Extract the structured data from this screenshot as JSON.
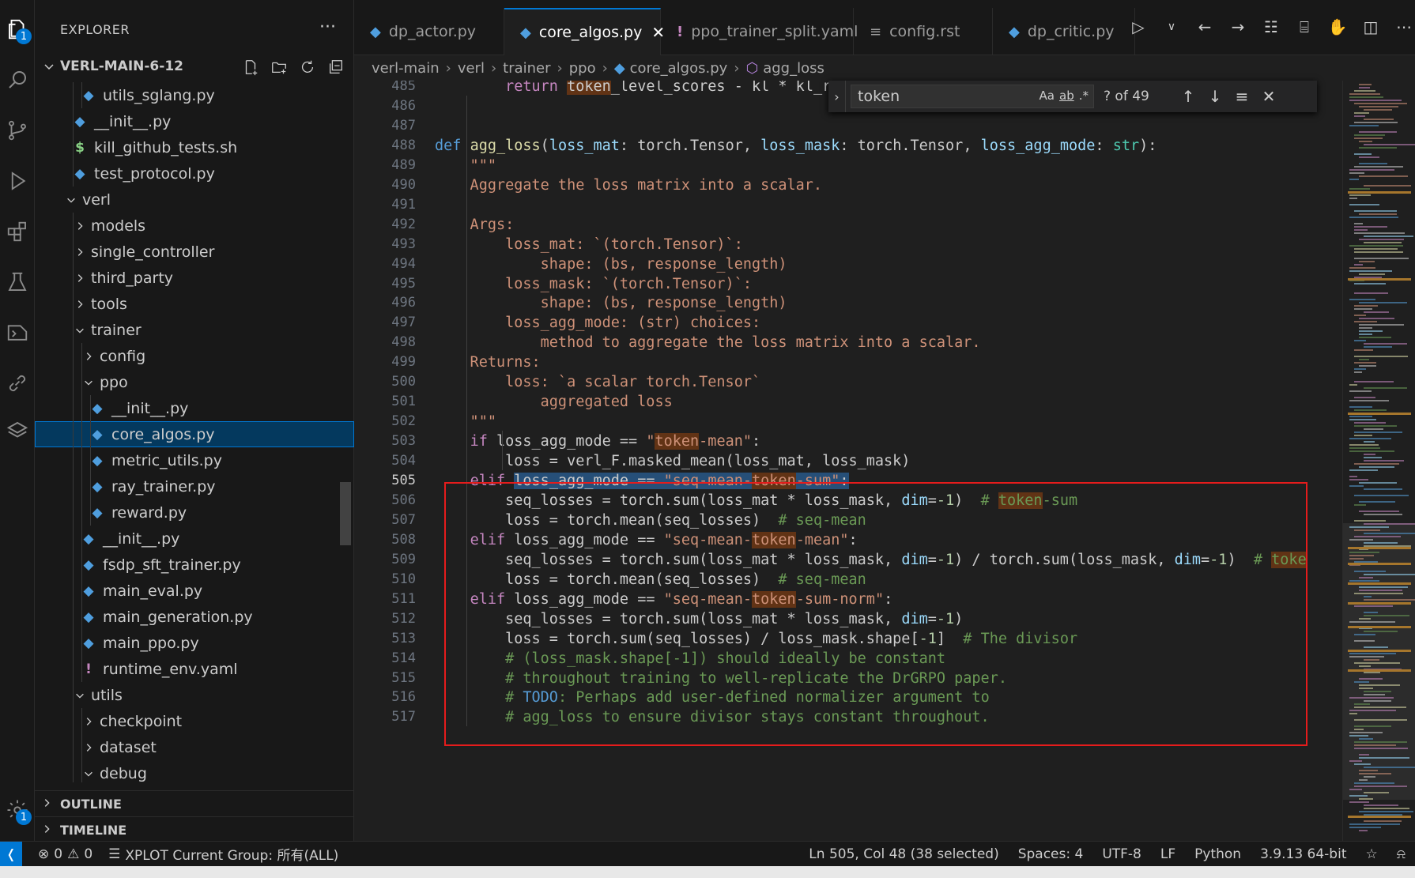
{
  "explorer": {
    "title": "EXPLORER",
    "more": "···",
    "root": "VERL-MAIN-6-12",
    "badge": "1",
    "tree": [
      {
        "label": "utils_sglang.py",
        "type": "py",
        "depth": 4
      },
      {
        "label": "__init__.py",
        "type": "py",
        "depth": 3
      },
      {
        "label": "kill_github_tests.sh",
        "type": "sh",
        "depth": 3
      },
      {
        "label": "test_protocol.py",
        "type": "py",
        "depth": 3
      },
      {
        "label": "verl",
        "type": "folder-open",
        "depth": 2
      },
      {
        "label": "models",
        "type": "folder",
        "depth": 3
      },
      {
        "label": "single_controller",
        "type": "folder",
        "depth": 3
      },
      {
        "label": "third_party",
        "type": "folder",
        "depth": 3
      },
      {
        "label": "tools",
        "type": "folder",
        "depth": 3
      },
      {
        "label": "trainer",
        "type": "folder-open",
        "depth": 3
      },
      {
        "label": "config",
        "type": "folder",
        "depth": 4
      },
      {
        "label": "ppo",
        "type": "folder-open",
        "depth": 4
      },
      {
        "label": "__init__.py",
        "type": "py",
        "depth": 5
      },
      {
        "label": "core_algos.py",
        "type": "py",
        "depth": 5,
        "selected": true
      },
      {
        "label": "metric_utils.py",
        "type": "py",
        "depth": 5
      },
      {
        "label": "ray_trainer.py",
        "type": "py",
        "depth": 5
      },
      {
        "label": "reward.py",
        "type": "py",
        "depth": 5
      },
      {
        "label": "__init__.py",
        "type": "py",
        "depth": 4
      },
      {
        "label": "fsdp_sft_trainer.py",
        "type": "py",
        "depth": 4
      },
      {
        "label": "main_eval.py",
        "type": "py",
        "depth": 4
      },
      {
        "label": "main_generation.py",
        "type": "py",
        "depth": 4
      },
      {
        "label": "main_ppo.py",
        "type": "py",
        "depth": 4
      },
      {
        "label": "runtime_env.yaml",
        "type": "yaml",
        "depth": 4
      },
      {
        "label": "utils",
        "type": "folder-open",
        "depth": 3
      },
      {
        "label": "checkpoint",
        "type": "folder",
        "depth": 4
      },
      {
        "label": "dataset",
        "type": "folder",
        "depth": 4
      },
      {
        "label": "debug",
        "type": "folder-open",
        "depth": 4
      }
    ],
    "outline": "OUTLINE",
    "timeline": "TIMELINE"
  },
  "tabs": [
    {
      "label": "dp_actor.py",
      "icon": "python-icon"
    },
    {
      "label": "core_algos.py",
      "icon": "python-icon",
      "active": true
    },
    {
      "label": "ppo_trainer_split.yaml",
      "icon": "yaml-icon"
    },
    {
      "label": "config.rst",
      "icon": "lines-icon"
    },
    {
      "label": "dp_critic.py",
      "icon": "python-icon"
    }
  ],
  "breadcrumb": [
    "verl-main",
    "verl",
    "trainer",
    "ppo",
    "core_algos.py",
    "agg_loss"
  ],
  "find": {
    "query": "token",
    "match_case": "Aa",
    "whole_word": "ab",
    "regex": ".*",
    "count": "? of 49"
  },
  "code": {
    "lines": [
      {
        "n": "485",
        "t": [
          [
            "        ",
            ""
          ],
          [
            "return",
            "ctl"
          ],
          [
            " ",
            ""
          ],
          [
            "token",
            "hl"
          ],
          [
            "_level_scores - kl * kl_rat",
            ""
          ]
        ]
      },
      {
        "n": "486",
        "t": []
      },
      {
        "n": "487",
        "t": []
      },
      {
        "n": "488",
        "t": [
          [
            "def",
            "kw"
          ],
          [
            " ",
            ""
          ],
          [
            "agg_loss",
            "fn"
          ],
          [
            "(",
            ""
          ],
          [
            "loss_mat",
            "prm"
          ],
          [
            ": torch.Tensor, ",
            ""
          ],
          [
            "loss_mask",
            "prm"
          ],
          [
            ": torch.Tensor, ",
            ""
          ],
          [
            "loss_agg_mode",
            "prm"
          ],
          [
            ": ",
            ""
          ],
          [
            "str",
            "cls"
          ],
          [
            "):",
            ""
          ]
        ]
      },
      {
        "n": "489",
        "t": [
          [
            "    \"\"\"",
            "str"
          ]
        ]
      },
      {
        "n": "490",
        "t": [
          [
            "    Aggregate the loss matrix into a scalar.",
            "str"
          ]
        ]
      },
      {
        "n": "491",
        "t": []
      },
      {
        "n": "492",
        "t": [
          [
            "    Args:",
            "str"
          ]
        ]
      },
      {
        "n": "493",
        "t": [
          [
            "        loss_mat: `(torch.Tensor)`:",
            "str"
          ]
        ]
      },
      {
        "n": "494",
        "t": [
          [
            "            shape: (bs, response_length)",
            "str"
          ]
        ]
      },
      {
        "n": "495",
        "t": [
          [
            "        loss_mask: `(torch.Tensor)`:",
            "str"
          ]
        ]
      },
      {
        "n": "496",
        "t": [
          [
            "            shape: (bs, response_length)",
            "str"
          ]
        ]
      },
      {
        "n": "497",
        "t": [
          [
            "        loss_agg_mode: (str) choices:",
            "str"
          ]
        ]
      },
      {
        "n": "498",
        "t": [
          [
            "            method to aggregate the loss matrix into a scalar.",
            "str"
          ]
        ]
      },
      {
        "n": "499",
        "t": [
          [
            "    Returns:",
            "str"
          ]
        ]
      },
      {
        "n": "500",
        "t": [
          [
            "        loss: `a scalar torch.Tensor`",
            "str"
          ]
        ]
      },
      {
        "n": "501",
        "t": [
          [
            "            aggregated loss",
            "str"
          ]
        ]
      },
      {
        "n": "502",
        "t": [
          [
            "    \"\"\"",
            "str"
          ]
        ]
      },
      {
        "n": "503",
        "t": [
          [
            "    ",
            ""
          ],
          [
            "if",
            "ctl"
          ],
          [
            " loss_agg_mode == ",
            ""
          ],
          [
            "\"",
            "str"
          ],
          [
            "token",
            "str hl"
          ],
          [
            "-mean\"",
            "str"
          ],
          [
            ":",
            ""
          ]
        ]
      },
      {
        "n": "504",
        "t": [
          [
            "        loss = verl_F.masked_mean(loss_mat, loss_mask)",
            ""
          ]
        ]
      },
      {
        "n": "505",
        "t": [
          [
            "    ",
            ""
          ],
          [
            "elif",
            "ctl"
          ],
          [
            " ",
            ""
          ],
          [
            "loss_agg_mode == ",
            "sel"
          ],
          [
            "\"seq-mean-",
            "str sel"
          ],
          [
            "token",
            "str hl"
          ],
          [
            "-sum\"",
            "str sel"
          ],
          [
            ":",
            "sel"
          ]
        ],
        "current": true
      },
      {
        "n": "506",
        "t": [
          [
            "        seq_losses = torch.sum(loss_mat * loss_mask, ",
            ""
          ],
          [
            "dim",
            "prm"
          ],
          [
            "=",
            ""
          ],
          [
            "-1",
            "num"
          ],
          [
            ")  ",
            ""
          ],
          [
            "# ",
            "cmt"
          ],
          [
            "token",
            "cmt hl"
          ],
          [
            "-sum",
            "cmt"
          ]
        ]
      },
      {
        "n": "507",
        "t": [
          [
            "        loss = torch.mean(seq_losses)  ",
            ""
          ],
          [
            "# seq-mean",
            "cmt"
          ]
        ]
      },
      {
        "n": "508",
        "t": [
          [
            "    ",
            ""
          ],
          [
            "elif",
            "ctl"
          ],
          [
            " loss_agg_mode == ",
            ""
          ],
          [
            "\"seq-mean-",
            "str"
          ],
          [
            "token",
            "str hl"
          ],
          [
            "-mean\"",
            "str"
          ],
          [
            ":",
            ""
          ]
        ]
      },
      {
        "n": "509",
        "t": [
          [
            "        seq_losses = torch.sum(loss_mat * loss_mask, ",
            ""
          ],
          [
            "dim",
            "prm"
          ],
          [
            "=",
            ""
          ],
          [
            "-1",
            "num"
          ],
          [
            ") / torch.sum(loss_mask, ",
            ""
          ],
          [
            "dim",
            "prm"
          ],
          [
            "=",
            ""
          ],
          [
            "-1",
            "num"
          ],
          [
            ")  ",
            ""
          ],
          [
            "# ",
            "cmt"
          ],
          [
            "toke",
            "cmt hl"
          ]
        ]
      },
      {
        "n": "510",
        "t": [
          [
            "        loss = torch.mean(seq_losses)  ",
            ""
          ],
          [
            "# seq-mean",
            "cmt"
          ]
        ]
      },
      {
        "n": "511",
        "t": [
          [
            "    ",
            ""
          ],
          [
            "elif",
            "ctl"
          ],
          [
            " loss_agg_mode == ",
            ""
          ],
          [
            "\"seq-mean-",
            "str"
          ],
          [
            "token",
            "str hl"
          ],
          [
            "-sum-norm\"",
            "str"
          ],
          [
            ":",
            ""
          ]
        ]
      },
      {
        "n": "512",
        "t": [
          [
            "        seq_losses = torch.sum(loss_mat * loss_mask, ",
            ""
          ],
          [
            "dim",
            "prm"
          ],
          [
            "=",
            ""
          ],
          [
            "-1",
            "num"
          ],
          [
            ")",
            ""
          ]
        ]
      },
      {
        "n": "513",
        "t": [
          [
            "        loss = torch.sum(seq_losses) / loss_mask.shape[",
            ""
          ],
          [
            "-1",
            "num"
          ],
          [
            "]  ",
            ""
          ],
          [
            "# The divisor",
            "cmt"
          ]
        ]
      },
      {
        "n": "514",
        "t": [
          [
            "        ",
            ""
          ],
          [
            "# (loss_mask.shape[-1]) should ideally be constant",
            "cmt"
          ]
        ]
      },
      {
        "n": "515",
        "t": [
          [
            "        ",
            ""
          ],
          [
            "# throughout training to well-replicate the DrGRPO paper.",
            "cmt"
          ]
        ]
      },
      {
        "n": "516",
        "t": [
          [
            "        ",
            ""
          ],
          [
            "# ",
            "cmt"
          ],
          [
            "TODO",
            "todo"
          ],
          [
            ": Perhaps add user-defined normalizer argument to",
            "cmt"
          ]
        ]
      },
      {
        "n": "517",
        "t": [
          [
            "        ",
            ""
          ],
          [
            "# agg_loss to ensure divisor stays constant throughout.",
            "cmt"
          ]
        ]
      }
    ]
  },
  "status": {
    "errors": "0",
    "warnings": "0",
    "xplot": "XPLOT Current Group: 所有(ALL)",
    "position": "Ln 505, Col 48 (38 selected)",
    "spaces": "Spaces: 4",
    "encoding": "UTF-8",
    "eol": "LF",
    "language": "Python",
    "interpreter": "3.9.13 64-bit"
  },
  "colors": {
    "accent": "#0078d4",
    "highlight_box": "#e51c1c",
    "match_highlight": "#613315"
  }
}
